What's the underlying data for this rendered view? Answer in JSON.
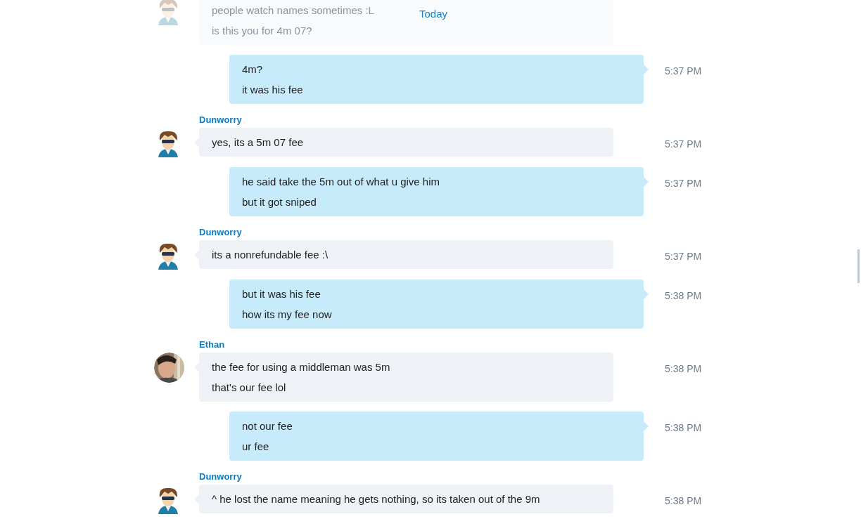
{
  "date_divider": "Today",
  "messages": [
    {
      "kind": "incoming",
      "faded": true,
      "avatar": {
        "kind": "cartoon"
      },
      "lines": [
        "people watch names sometimes :L",
        "is this you for 4m 07?"
      ]
    },
    {
      "kind": "outgoing",
      "faded": false,
      "lines": [
        "4m?",
        "it was his fee"
      ],
      "time": "5:37 PM"
    },
    {
      "kind": "incoming",
      "faded": false,
      "sender": "Dunworry",
      "avatar": {
        "kind": "cartoon"
      },
      "lines": [
        "yes, its a 5m 07 fee"
      ],
      "time": "5:37 PM"
    },
    {
      "kind": "outgoing",
      "faded": false,
      "lines": [
        "he said take the 5m out of what u give him",
        "but it got sniped"
      ],
      "time": "5:37 PM"
    },
    {
      "kind": "incoming",
      "faded": false,
      "sender": "Dunworry",
      "avatar": {
        "kind": "cartoon"
      },
      "lines": [
        "its a nonrefundable fee :\\"
      ],
      "time": "5:37 PM"
    },
    {
      "kind": "outgoing",
      "faded": false,
      "lines": [
        "but it was his fee",
        "how its my fee now"
      ],
      "time": "5:38 PM"
    },
    {
      "kind": "incoming",
      "faded": false,
      "sender": "Ethan",
      "lines": [
        "the fee for using a middleman was 5m",
        "that's our fee lol"
      ],
      "time": "5:38 PM"
    },
    {
      "kind": "outgoing",
      "faded": false,
      "lines": [
        "not our fee",
        "ur fee"
      ],
      "time": "5:38 PM"
    },
    {
      "kind": "incoming",
      "faded": false,
      "sender": "Dunworry",
      "avatar": {
        "kind": "cartoon"
      },
      "lines": [
        "^ he lost the name meaning he gets nothing, so its taken out of the 9m"
      ],
      "time": "5:38 PM"
    }
  ]
}
